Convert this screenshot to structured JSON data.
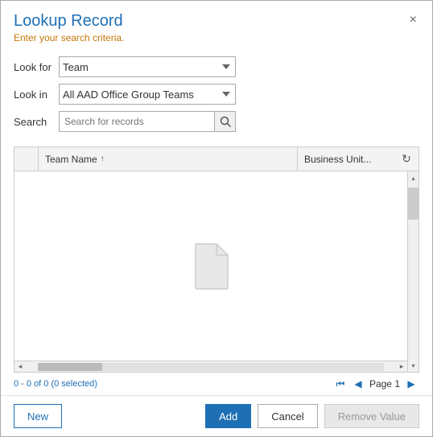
{
  "dialog": {
    "title": "Lookup Record",
    "subtitle": "Enter your search criteria.",
    "close_label": "×"
  },
  "form": {
    "look_for_label": "Look for",
    "look_in_label": "Look in",
    "search_label": "Search",
    "look_for_value": "Team",
    "look_in_value": "All AAD Office Group Teams",
    "look_for_options": [
      "Team"
    ],
    "look_in_options": [
      "All AAD Office Group Teams"
    ],
    "search_placeholder": "Search for records"
  },
  "table": {
    "col_team_name": "Team Name",
    "col_business_unit": "Business Unit...",
    "sort_indicator": "↑",
    "rows": []
  },
  "status": {
    "record_count": "0 - 0 of 0 (0 selected)",
    "page_label": "Page 1"
  },
  "footer": {
    "new_label": "New",
    "add_label": "Add",
    "cancel_label": "Cancel",
    "remove_value_label": "Remove Value"
  },
  "icons": {
    "search": "🔍",
    "refresh": "↻",
    "first_page": "⏮",
    "prev_page": "◀",
    "next_page": "▶",
    "scroll_left": "◂",
    "scroll_right": "▸",
    "scroll_up": "▴",
    "scroll_down": "▾"
  }
}
